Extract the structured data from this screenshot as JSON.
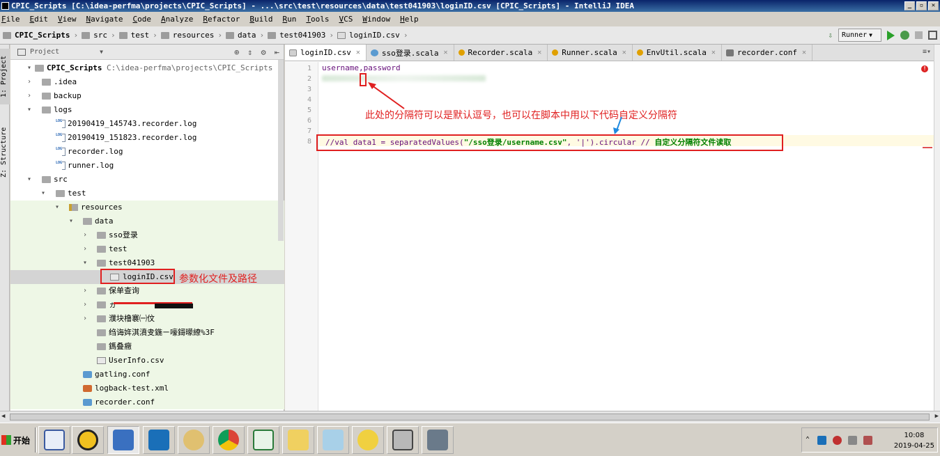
{
  "window": {
    "title": "CPIC_Scripts [C:\\idea-perfma\\projects\\CPIC_Scripts] - ...\\src\\test\\resources\\data\\test041903\\loginID.csv [CPIC_Scripts] - IntelliJ IDEA",
    "min": "_",
    "max": "▫",
    "close": "✕"
  },
  "menu": [
    "File",
    "Edit",
    "View",
    "Navigate",
    "Code",
    "Analyze",
    "Refactor",
    "Build",
    "Run",
    "Tools",
    "VCS",
    "Window",
    "Help"
  ],
  "breadcrumb": [
    "CPIC_Scripts",
    "src",
    "test",
    "resources",
    "data",
    "test041903",
    "loginID.csv"
  ],
  "toolbar": {
    "run_config": "Runner"
  },
  "toolstrip": {
    "project_tab": "1: Project",
    "structure_tab": "Z: Structure"
  },
  "project_panel": {
    "title": "Project",
    "root_name": "CPIC_Scripts",
    "root_path": "C:\\idea-perfma\\projects\\CPIC_Scripts",
    "items": [
      {
        "label": ".idea"
      },
      {
        "label": "backup"
      },
      {
        "label": "logs"
      },
      {
        "label": "20190419_145743.recorder.log"
      },
      {
        "label": "20190419_151823.recorder.log"
      },
      {
        "label": "recorder.log"
      },
      {
        "label": "runner.log"
      },
      {
        "label": "src"
      },
      {
        "label": "test"
      },
      {
        "label": "resources"
      },
      {
        "label": "data"
      },
      {
        "label": "sso登录"
      },
      {
        "label": "test"
      },
      {
        "label": "test041903"
      },
      {
        "label": "loginID.csv"
      },
      {
        "label": "保单查询"
      },
      {
        "label": "ヵ"
      },
      {
        "label": "濮块橹褰㈠伩"
      },
      {
        "label": "绉诲姩淇濆叏鍦ㄧ嚎鎶曚繚%3F"
      },
      {
        "label": "鎷叠癥"
      },
      {
        "label": "UserInfo.csv"
      },
      {
        "label": "gatling.conf"
      },
      {
        "label": "logback-test.xml"
      },
      {
        "label": "recorder.conf"
      }
    ]
  },
  "annotations": {
    "file_path_note": "参数化文件及路径",
    "separator_note": "此处的分隔符可以是默认逗号，也可以在脚本中用以下代码自定义分隔符"
  },
  "editor": {
    "tabs": [
      {
        "label": "loginID.csv",
        "icon": "csv-icon",
        "active": true
      },
      {
        "label": "sso登录.scala",
        "icon": "scala-class-icon"
      },
      {
        "label": "Recorder.scala",
        "icon": "scala-object-icon"
      },
      {
        "label": "Runner.scala",
        "icon": "scala-object-icon"
      },
      {
        "label": "EnvUtil.scala",
        "icon": "scala-object-icon"
      },
      {
        "label": "recorder.conf",
        "icon": "conf-icon"
      }
    ],
    "line_numbers": [
      "1",
      "2",
      "3",
      "4",
      "5",
      "6",
      "7",
      "8"
    ],
    "line1": "username,password",
    "line8_pre": "//val data1 = separatedValues(",
    "line8_str": "\"/sso登录/username.csv\"",
    "line8_mid": ", '|').circular // ",
    "line8_comment": "自定义分隔符文件读取"
  },
  "taskbar": {
    "start_label": "开始",
    "time": "10:08",
    "date": "2019-04-25"
  }
}
